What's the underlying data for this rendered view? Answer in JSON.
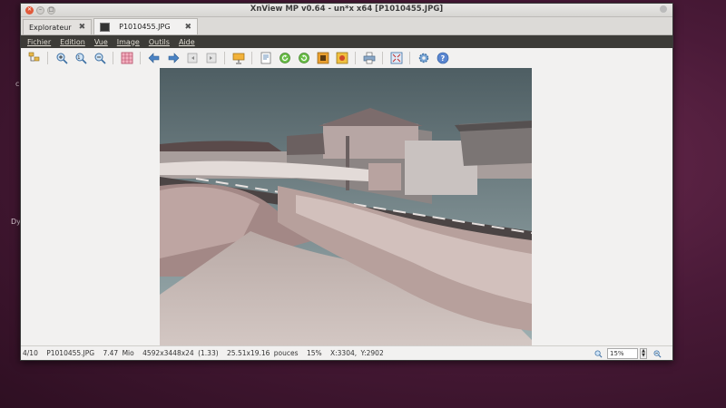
{
  "window": {
    "title": "XnView MP v0.64 - un*x x64 [P1010455.JPG]"
  },
  "tabs": [
    {
      "label": "Explorateur",
      "close": "✖"
    },
    {
      "label": "P1010455.JPG",
      "close": "✖"
    }
  ],
  "menu": [
    "Fichier",
    "Edition",
    "Vue",
    "Image",
    "Outils",
    "Aide"
  ],
  "toolbar_icons": [
    "browser-icon",
    "zoom-in-icon",
    "zoom-fit-icon",
    "zoom-out-icon",
    "grid-icon",
    "previous-icon",
    "next-icon",
    "first-icon",
    "last-icon",
    "slideshow-icon",
    "properties-icon",
    "rotate-left-icon",
    "rotate-right-icon",
    "crop-icon",
    "adjust-icon",
    "print-icon",
    "fullscreen-icon",
    "settings-icon",
    "help-icon"
  ],
  "status": {
    "index": "4/10",
    "filename": "P1010455.JPG",
    "filesize": "7.47 Mio",
    "dimensions": "4592x3448x24 (1.33)",
    "print_size": "25.51x19.16 pouces",
    "zoom_pct": "15%",
    "coords": "X:3304, Y:2902"
  },
  "zoom_field": "15%",
  "desktop": {
    "glyph1": "c",
    "glyph2": "Dy"
  },
  "colors": {
    "menubar": "#3c3b37",
    "close_btn": "#e15a3b",
    "desktop": "#4a1a38"
  }
}
